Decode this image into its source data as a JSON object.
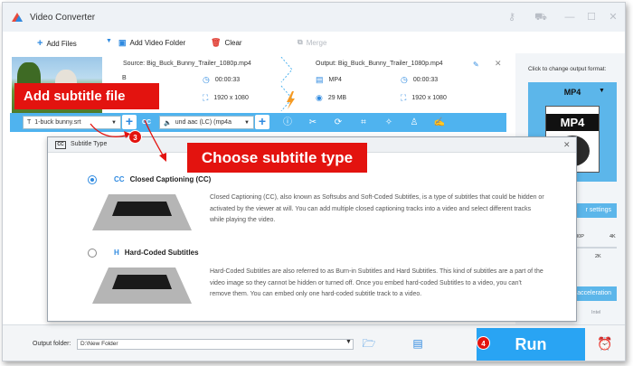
{
  "app": {
    "title": "Video Converter",
    "colors": {
      "accent": "#2f8ae0",
      "edit_bar": "#4fb3ef",
      "run": "#29a4f3",
      "callout": "#e3130f"
    }
  },
  "titlebar": {
    "icons": [
      "key-icon",
      "cart-icon",
      "minimize-icon",
      "maximize-icon",
      "close-icon"
    ]
  },
  "toolbar": {
    "add_files": "Add Files",
    "add_video_folder": "Add Video Folder",
    "clear": "Clear",
    "merge": "Merge"
  },
  "file": {
    "source": "Source: Big_Buck_Bunny_Trailer_1080p.mp4",
    "output": "Output: Big_Buck_Bunny_Trailer_1080p.mp4",
    "src_duration": "00:00:33",
    "src_size": "B",
    "src_resolution": "1920 x 1080",
    "out_format": "MP4",
    "out_duration": "00:00:33",
    "out_size": "29 MB",
    "out_resolution": "1920 x 1080"
  },
  "editbar": {
    "subtitle": "1-buck bunny.srt",
    "audio": "und aac (LC) (mp4a",
    "cc_label": "CC"
  },
  "right_panel": {
    "click_label": "Click to change output format:",
    "format": "MP4",
    "format_icon_label": "MP4",
    "settings_btn": "r settings",
    "quality_low": "1080P",
    "quality_high": "4K",
    "quality_small": "2K",
    "accel_btn": "acceleration",
    "intel": "Intel"
  },
  "bottom": {
    "output_folder_label": "Output folder:",
    "output_folder_value": "D:\\New Folder",
    "run": "Run"
  },
  "dialog": {
    "title": "Subtitle Type",
    "options": [
      {
        "icon": "CC",
        "label": "Closed Captioning (CC)",
        "selected": true,
        "desc": "Closed Captioning (CC), also known as Softsubs and Soft-Coded Subtitles, is a type of subtitles that could be hidden or activated by the viewer at will. You can add multiple closed captioning tracks into a video and select different tracks while playing the video."
      },
      {
        "icon": "H",
        "label": "Hard-Coded Subtitles",
        "selected": false,
        "desc": "Hard-Coded Subtitles are also referred to as Burn-in Subtitles and Hard Subtitles. This kind of subtitles are a part of the video image so they cannot be hidden or turned off. Once you embed hard-coded Subtitles to a video, you can't remove them. You can embed only one hard-coded subtitle track to a video."
      }
    ]
  },
  "annotations": {
    "add_subtitle": "Add subtitle file",
    "choose_type": "Choose subtitle type",
    "step3": "3",
    "step4": "4"
  }
}
